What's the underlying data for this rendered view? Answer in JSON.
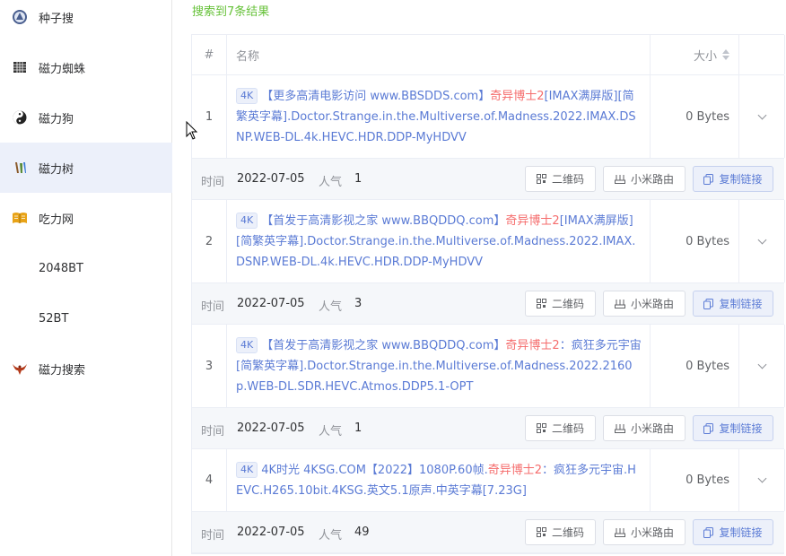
{
  "sidebar": {
    "items": [
      {
        "label": "种子搜",
        "icon": "compass-icon"
      },
      {
        "label": "磁力蜘蛛",
        "icon": "spider-icon"
      },
      {
        "label": "磁力狗",
        "icon": "yinyang-icon"
      },
      {
        "label": "磁力树",
        "icon": "tree-icon"
      },
      {
        "label": "吃力网",
        "icon": "book-icon"
      },
      {
        "label": "2048BT",
        "icon": ""
      },
      {
        "label": "52BT",
        "icon": ""
      },
      {
        "label": "磁力搜索",
        "icon": "bird-icon"
      }
    ],
    "active_index": 3
  },
  "summary": "搜索到7条结果",
  "table": {
    "headers": {
      "index": "#",
      "name": "名称",
      "size": "大小"
    },
    "meta_labels": {
      "time": "时间",
      "popularity": "人气"
    },
    "buttons": {
      "qr": "二维码",
      "xiaomi": "小米路由",
      "copy": "复制链接"
    },
    "rows": [
      {
        "index": "1",
        "tag": "4K",
        "name_pre": "【更多高清电影访问 www.BBSDDS.com】",
        "name_hl": "奇异博士2",
        "name_post": "[IMAX满屏版][简繁英字幕].Doctor.Strange.in.the.Multiverse.of.Madness.2022.IMAX.DSNP.WEB-DL.4k.HEVC.HDR.DDP-MyHDVV",
        "size": "0 Bytes",
        "time": "2022-07-05",
        "popularity": "1"
      },
      {
        "index": "2",
        "tag": "4K",
        "name_pre": "【首发于高清影视之家 www.BBQDDQ.com】",
        "name_hl": "奇异博士2",
        "name_post": "[IMAX满屏版][简繁英字幕].Doctor.Strange.in.the.Multiverse.of.Madness.2022.IMAX.DSNP.WEB-DL.4k.HEVC.HDR.DDP-MyHDVV",
        "size": "0 Bytes",
        "time": "2022-07-05",
        "popularity": "3"
      },
      {
        "index": "3",
        "tag": "4K",
        "name_pre": "【首发于高清影视之家 www.BBQDDQ.com】",
        "name_hl": "奇异博士2",
        "name_post": "：疯狂多元宇宙[简繁英字幕].Doctor.Strange.in.the.Multiverse.of.Madness.2022.2160p.WEB-DL.SDR.HEVC.Atmos.DDP5.1-OPT",
        "size": "0 Bytes",
        "time": "2022-07-05",
        "popularity": "1"
      },
      {
        "index": "4",
        "tag": "4K",
        "name_pre": "4K时光 4KSG.COM【2022】1080P.60帧.",
        "name_hl": "奇异博士2",
        "name_post": "：疯狂多元宇宙.HEVC.H265.10bit.4KSG.英文5.1原声.中英字幕[7.23G]",
        "size": "0 Bytes",
        "time": "2022-07-05",
        "popularity": "49"
      }
    ]
  },
  "colors": {
    "accent": "#5b7bd5",
    "highlight": "#f56c6c",
    "summary": "#67c23a",
    "active_bg": "#ecf0fa"
  }
}
